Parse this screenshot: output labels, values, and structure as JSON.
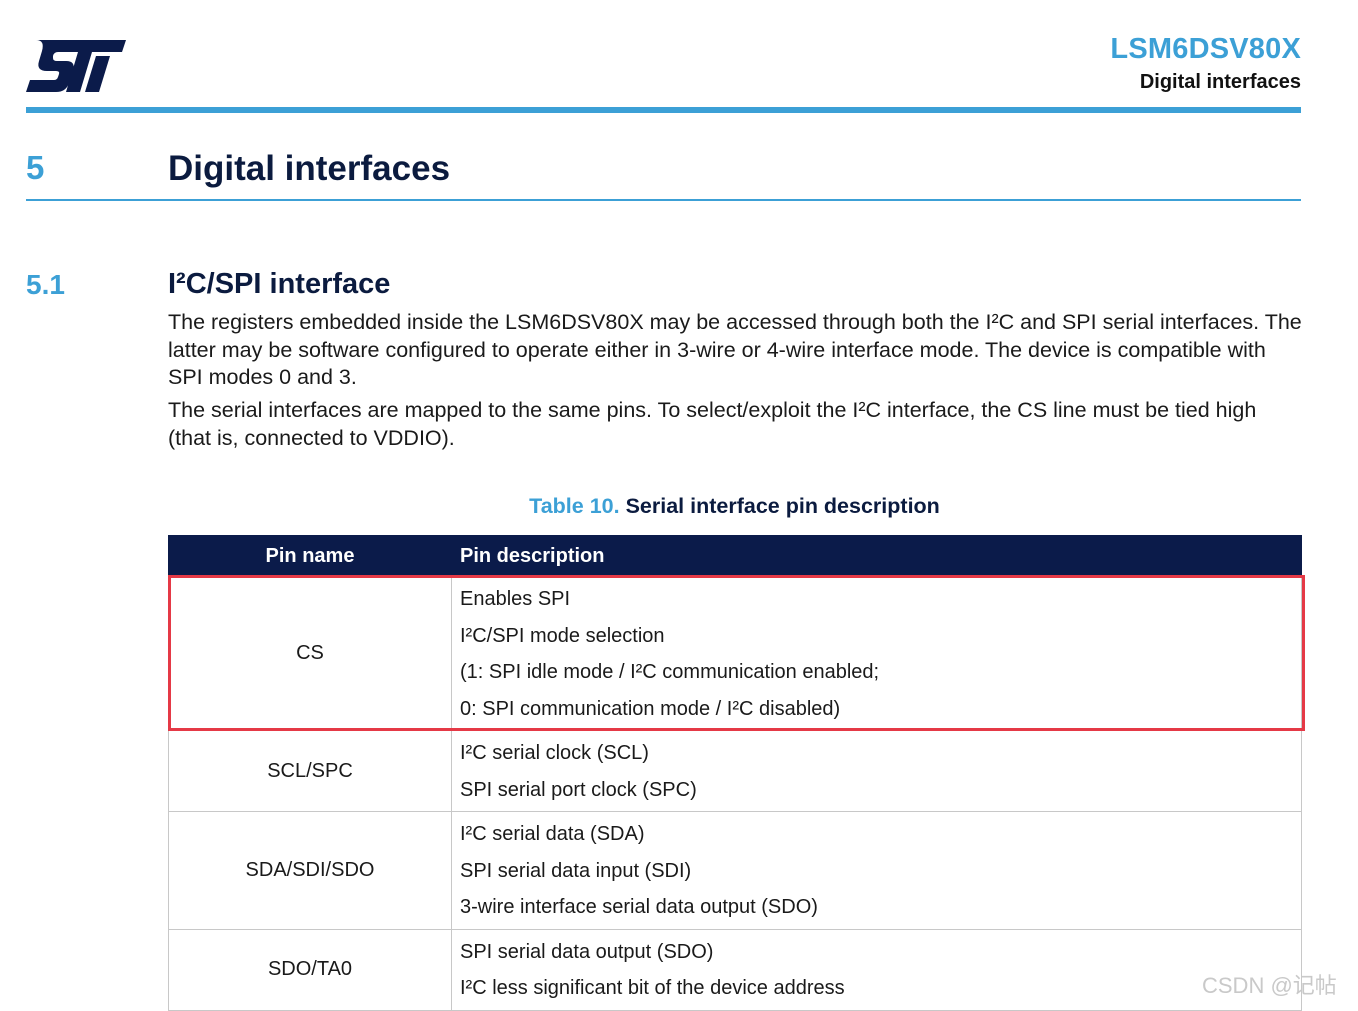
{
  "header": {
    "logo": "ST",
    "doc_title": "LSM6DSV80X",
    "doc_subtitle": "Digital interfaces"
  },
  "section": {
    "number": "5",
    "title": "Digital interfaces"
  },
  "subsection": {
    "number": "5.1",
    "title": "I²C/SPI interface",
    "paragraphs": [
      "The registers embedded inside the LSM6DSV80X may be accessed through both the I²C and SPI serial interfaces. The latter may be software configured to operate either in 3-wire or 4-wire interface mode. The device is compatible with SPI modes 0 and 3.",
      "The serial interfaces are mapped to the same pins. To select/exploit the I²C interface, the CS line must be tied high (that is, connected to VDDIO)."
    ]
  },
  "table": {
    "caption_number": "Table 10.",
    "caption_title": "Serial interface pin description",
    "headers": [
      "Pin name",
      "Pin description"
    ],
    "rows": [
      {
        "pin": "CS",
        "lines": [
          "Enables SPI",
          "I²C/SPI mode selection",
          "(1: SPI idle mode / I²C communication enabled;",
          "0: SPI communication mode / I²C disabled)"
        ]
      },
      {
        "pin": "SCL/SPC",
        "lines": [
          "I²C serial clock (SCL)",
          "SPI serial port clock (SPC)"
        ]
      },
      {
        "pin": "SDA/SDI/SDO",
        "lines": [
          "I²C serial data (SDA)",
          "SPI serial data input (SDI)",
          "3-wire interface serial data output (SDO)"
        ]
      },
      {
        "pin": "SDO/TA0",
        "lines": [
          "SPI serial data output (SDO)",
          "I²C less significant bit of the device address"
        ]
      }
    ]
  },
  "highlight_color": "#e53946",
  "accent_color": "#3ca0d6",
  "header_color": "#0b1b4a",
  "watermark": "CSDN @记帖"
}
